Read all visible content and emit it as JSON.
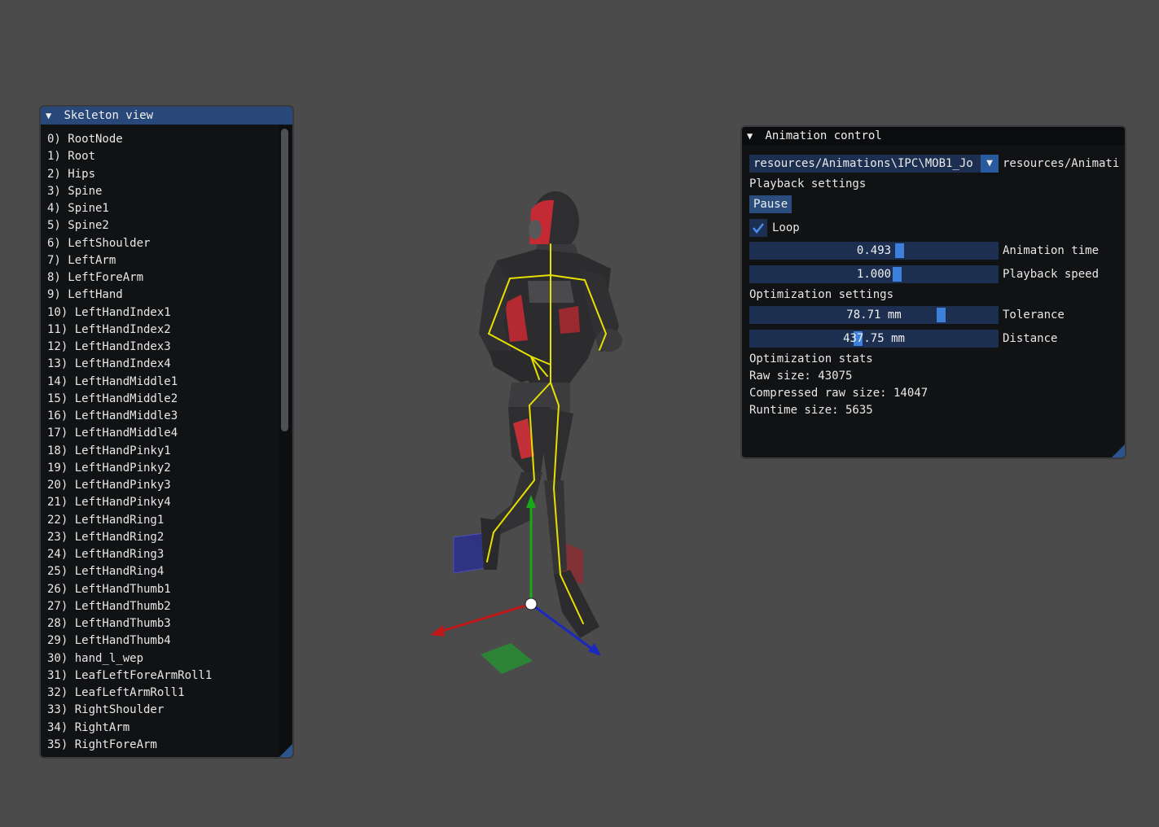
{
  "skeleton_view": {
    "title": "Skeleton view",
    "items": [
      "0) RootNode",
      "1) Root",
      "2) Hips",
      "3) Spine",
      "4) Spine1",
      "5) Spine2",
      "6) LeftShoulder",
      "7) LeftArm",
      "8) LeftForeArm",
      "9) LeftHand",
      "10) LeftHandIndex1",
      "11) LeftHandIndex2",
      "12) LeftHandIndex3",
      "13) LeftHandIndex4",
      "14) LeftHandMiddle1",
      "15) LeftHandMiddle2",
      "16) LeftHandMiddle3",
      "17) LeftHandMiddle4",
      "18) LeftHandPinky1",
      "19) LeftHandPinky2",
      "20) LeftHandPinky3",
      "21) LeftHandPinky4",
      "22) LeftHandRing1",
      "23) LeftHandRing2",
      "24) LeftHandRing3",
      "25) LeftHandRing4",
      "26) LeftHandThumb1",
      "27) LeftHandThumb2",
      "28) LeftHandThumb3",
      "29) LeftHandThumb4",
      "30) hand_l_wep",
      "31) LeafLeftForeArmRoll1",
      "32) LeafLeftArmRoll1",
      "33) RightShoulder",
      "34) RightArm",
      "35) RightForeArm"
    ]
  },
  "animation_control": {
    "title": "Animation control",
    "animation_combo_value": "resources/Animations\\IPC\\MOB1_Jo",
    "animation_combo_label": "resources/Animati",
    "playback_header": "Playback settings",
    "pause_label": "Pause",
    "loop_label": "Loop",
    "loop_checked": true,
    "animation_time_value": "0.493",
    "animation_time_label": "Animation time",
    "playback_speed_value": "1.000",
    "playback_speed_label": "Playback speed",
    "optimization_header": "Optimization settings",
    "tolerance_value": "78.71 mm",
    "tolerance_label": "Tolerance",
    "distance_value": "437.75 mm",
    "distance_label": "Distance",
    "stats_header": "Optimization stats",
    "raw_size": "Raw size: 43075",
    "compressed_raw_size": "Compressed raw size: 14047",
    "runtime_size": "Runtime size: 5635"
  },
  "colors": {
    "background": "#4b4b4b",
    "panel_bg": "#111214",
    "title_active": "#28487a",
    "frame_bg": "#1c2f50",
    "accent": "#3d80dc",
    "gizmo_x": "#c01818",
    "gizmo_y": "#18a818",
    "gizmo_z": "#1828c0",
    "bones": "#e6e000"
  }
}
